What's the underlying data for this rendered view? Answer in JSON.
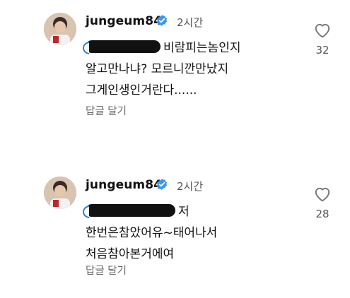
{
  "comments": [
    {
      "username": "jungeum84",
      "time": "2시간",
      "lines": [
        "비람피는놈인지",
        "알고만나냐? 모르니깐만났지",
        "그게인생인거란다......"
      ],
      "reply_label": "답글 달기",
      "like_count": "32",
      "avatar_icon": "user-photo",
      "verified_icon": "verified-badge-icon",
      "accent": "#3897f0"
    },
    {
      "username": "jungeum84",
      "time": "2시간",
      "lines": [
        "저",
        "한번은참았어유~태어나서",
        "처음참아본거에여"
      ],
      "reply_label": "답글 달기",
      "like_count": "28",
      "avatar_icon": "user-photo",
      "verified_icon": "verified-badge-icon",
      "accent": "#3897f0"
    }
  ]
}
